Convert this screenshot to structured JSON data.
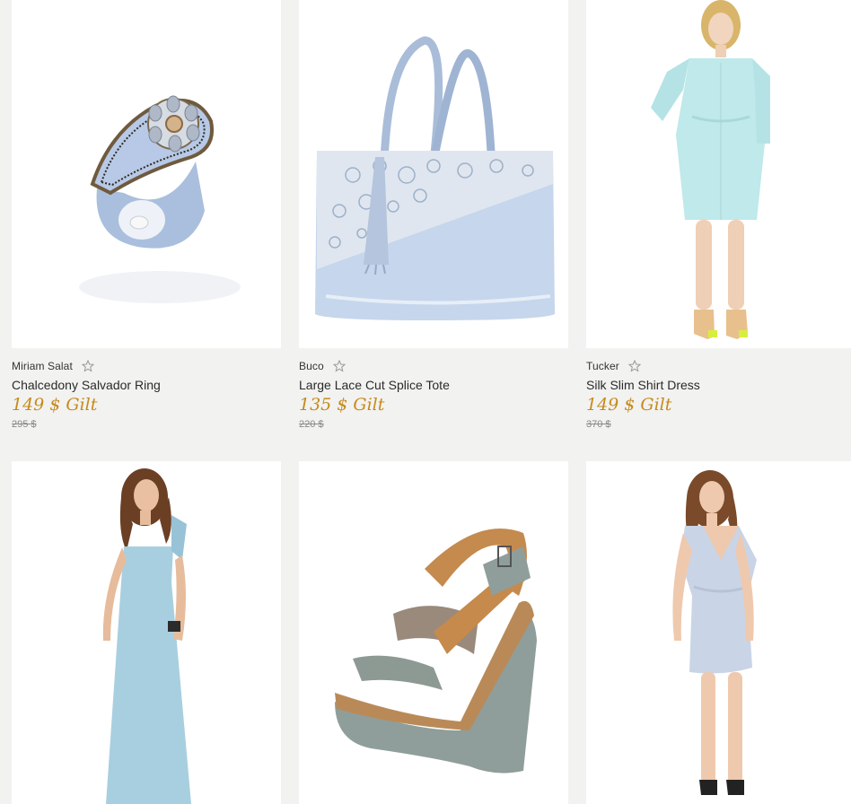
{
  "colors": {
    "page_background": "#f2f2f0",
    "card_background": "#ffffff",
    "sale_price": "#c78a1c",
    "original_price": "#888888"
  },
  "products": [
    {
      "brand": "Miriam Salat",
      "name": "Chalcedony Salvador Ring",
      "sale_price": "149 $ Gilt",
      "original_price": "295 $",
      "icon": "ring-image"
    },
    {
      "brand": "Buco",
      "name": "Large Lace Cut Splice Tote",
      "sale_price": "135 $ Gilt",
      "original_price": "220 $",
      "icon": "tote-bag-image"
    },
    {
      "brand": "Tucker",
      "name": "Silk Slim Shirt Dress",
      "sale_price": "149 $ Gilt",
      "original_price": "370 $",
      "icon": "shirt-dress-image"
    },
    {
      "icon": "maxi-dress-image"
    },
    {
      "icon": "wedge-sandal-image"
    },
    {
      "icon": "draped-dress-image"
    }
  ]
}
